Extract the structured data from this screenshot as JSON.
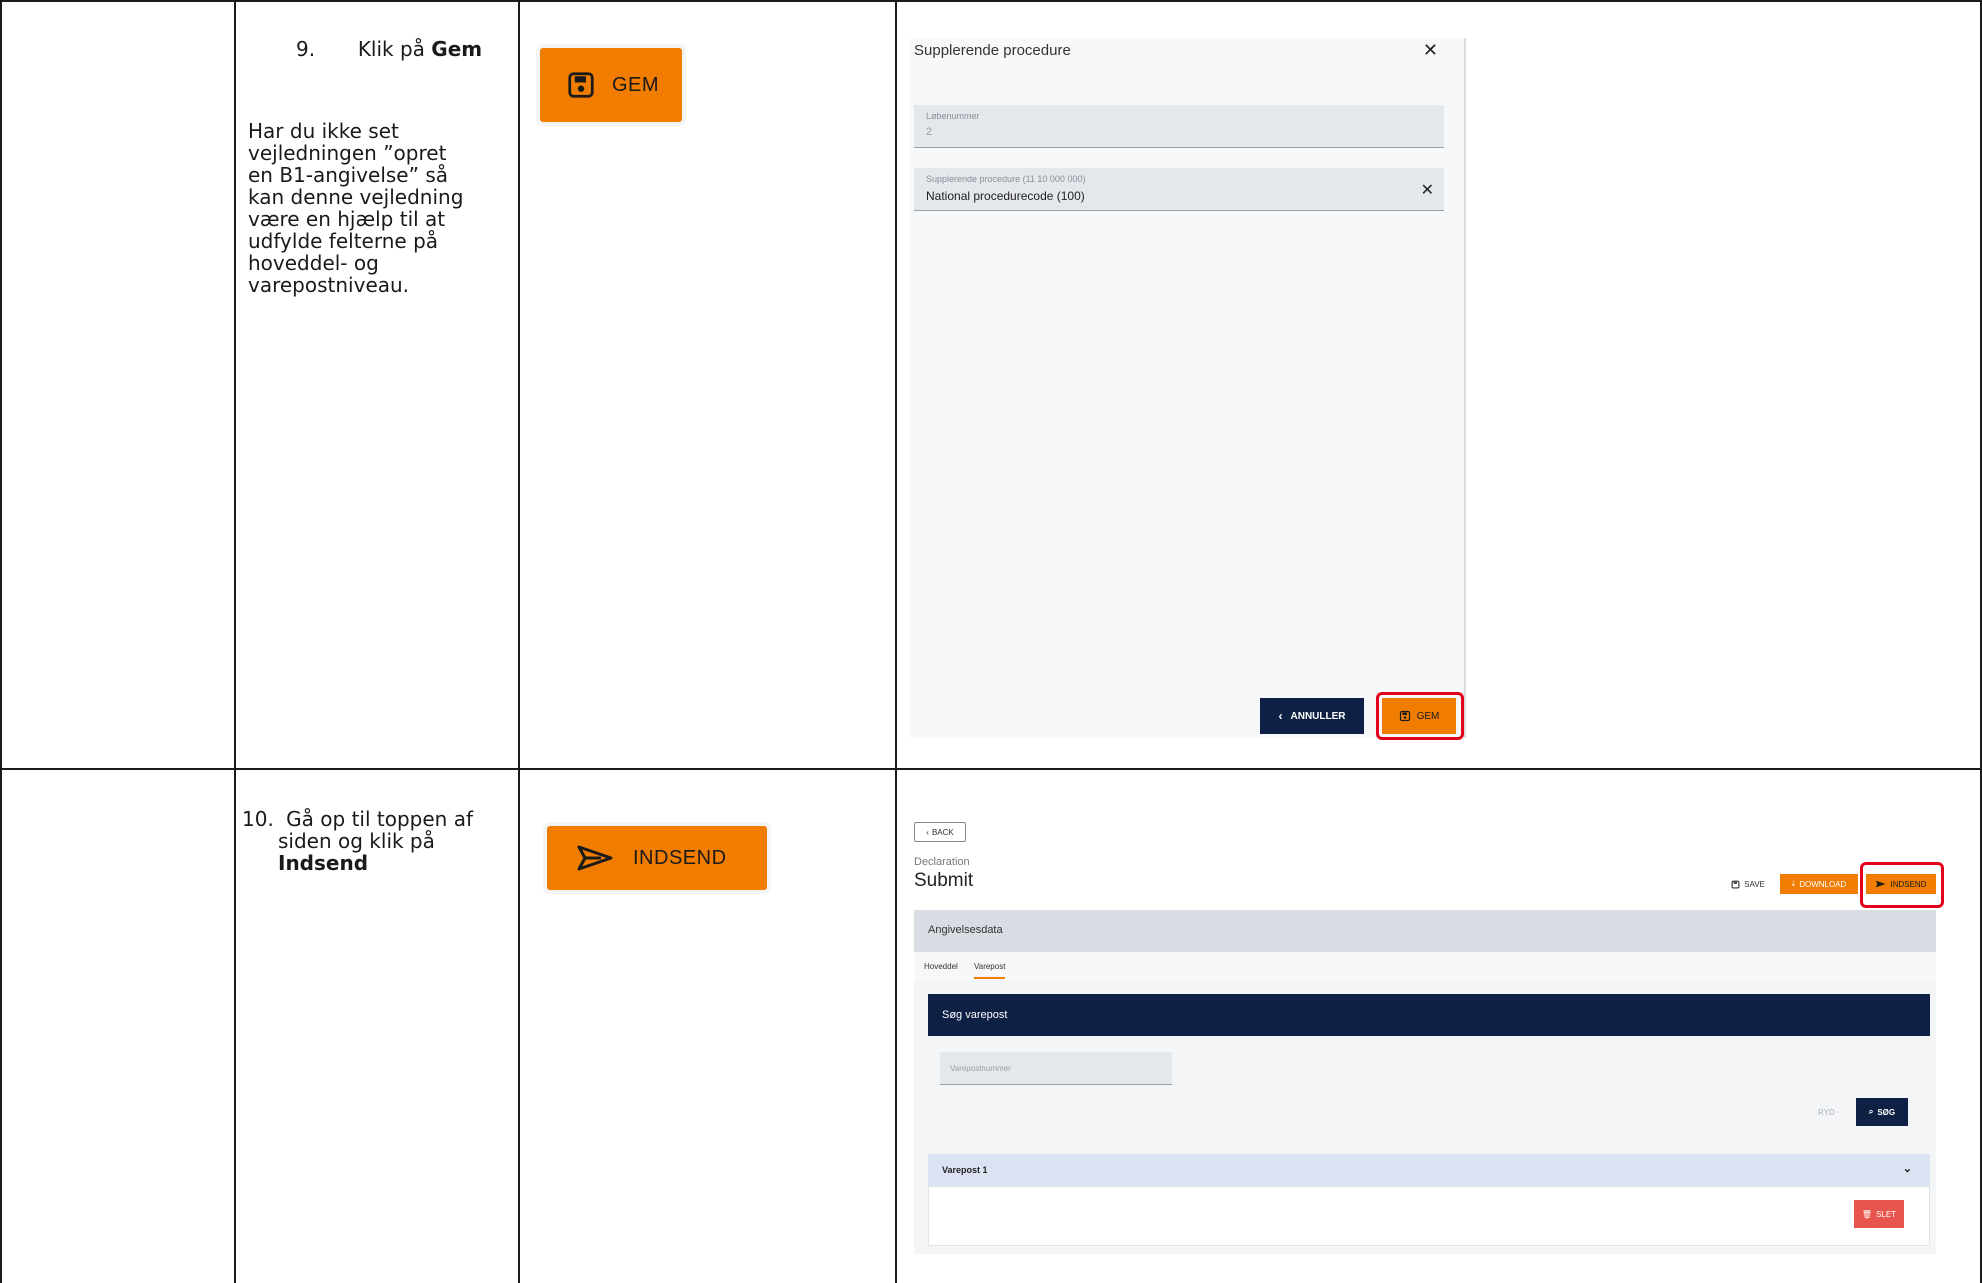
{
  "rows": [
    {
      "step_number": "9.",
      "step_text": "Klik på ",
      "step_bold": "Gem",
      "note_lines": [
        "Har du ikke set",
        "vejledningen ”opret",
        "en B1-angivelse” så",
        "kan denne vejledning",
        "være en hjælp til at",
        "udfylde felterne på",
        "hoveddel- og",
        "varepostniveau."
      ],
      "button_label": "GEM",
      "button_icon": "save-icon"
    },
    {
      "step_number": "10.",
      "step_lines": [
        "Gå op til toppen af",
        "siden og klik på"
      ],
      "step_bold": "Indsend",
      "button_label": "INDSEND",
      "button_icon": "send-icon"
    }
  ],
  "dialog": {
    "title": "Supplerende procedure",
    "field1_label": "Løbenummer",
    "field1_value": "2",
    "field2_label": "Supplerende procedure (11 10 000 000)",
    "field2_value": "National procedurecode  (100)",
    "cancel_label": "ANNULLER",
    "save_label": "GEM"
  },
  "submit_page": {
    "back_label": "BACK",
    "kicker": "Declaration",
    "title": "Submit",
    "save_label": "SAVE",
    "download_label": "DOWNLOAD",
    "submit_label": "INDSEND",
    "section_title": "Angivelsesdata",
    "tabs": [
      "Hoveddel",
      "Varepost"
    ],
    "active_tab": "Varepost",
    "search_title": "Søg varepost",
    "search_placeholder": "Varepostnummer",
    "clear_label": "RYD",
    "search_label": "SØG",
    "item_title": "Varepost 1",
    "delete_label": "SLET"
  },
  "colors": {
    "accent": "#f07d00",
    "navy": "#0f2045",
    "highlight": "#e3001b",
    "danger": "#e8554e"
  }
}
